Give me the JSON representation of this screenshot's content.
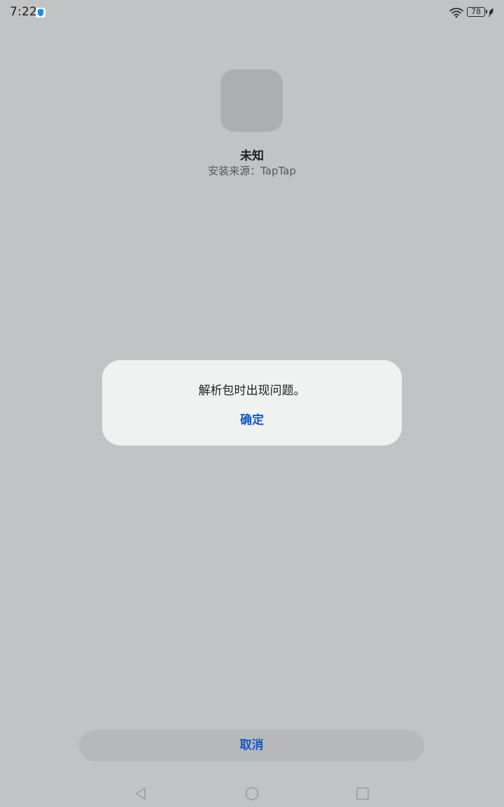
{
  "status_bar": {
    "time": "7:22",
    "battery_level": "78",
    "icons": [
      "shield-notification-icon",
      "wifi-icon",
      "battery-icon",
      "power-saving-leaf-icon"
    ]
  },
  "app_info": {
    "icon": "app-placeholder-icon",
    "name": "未知",
    "install_source": "安装来源：TapTap"
  },
  "dialog": {
    "message": "解析包时出现问题。",
    "ok_label": "确定"
  },
  "footer": {
    "cancel_label": "取消"
  },
  "nav_bar": {
    "icons": [
      "back-icon",
      "home-icon",
      "recents-icon"
    ]
  },
  "colors": {
    "background": "#c2c3c5",
    "dialog_background": "#f0f1f1",
    "accent": "#1456c8"
  }
}
